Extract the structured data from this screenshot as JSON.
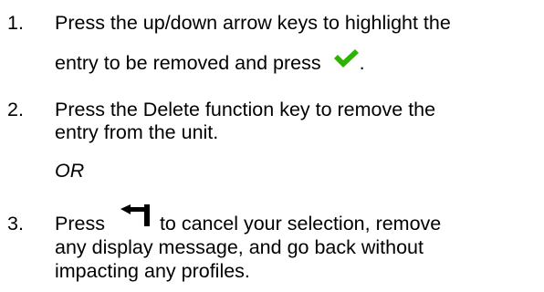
{
  "steps": [
    {
      "number": "1.",
      "line1": "Press the up/down arrow keys to highlight the",
      "line2_before_icon": "entry to be removed and press",
      "line2_after_icon": ".",
      "icon": "checkmark-icon",
      "icon_color": "#2db400"
    },
    {
      "number": "2.",
      "line1": "Press the Delete function key to remove the",
      "line2": "entry from the unit."
    },
    {
      "number": "3.",
      "line1_before_icon": "Press",
      "icon": "back-arrow-icon",
      "line1_after_icon": "to cancel your selection, remove",
      "line2": "any display message, and go back without",
      "line3": "impacting any profiles."
    }
  ],
  "or_text": "OR"
}
